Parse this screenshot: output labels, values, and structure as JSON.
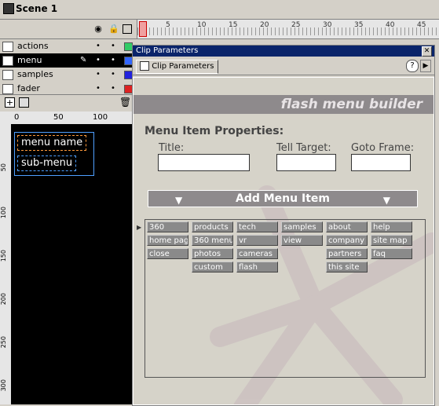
{
  "scene": {
    "title": "Scene 1"
  },
  "timeline": {
    "ruler_numbers": [
      "1",
      "5",
      "10",
      "15",
      "20",
      "25",
      "30",
      "35",
      "40",
      "45"
    ]
  },
  "layers": [
    {
      "name": "actions",
      "color": "#33cc66",
      "selected": false
    },
    {
      "name": "menu",
      "color": "#3366ff",
      "selected": true
    },
    {
      "name": "samples",
      "color": "#2222dd",
      "selected": false
    },
    {
      "name": "fader",
      "color": "#dd2222",
      "selected": false
    }
  ],
  "stage": {
    "ruler_numbers": [
      "0",
      "50",
      "100"
    ],
    "vruler_numbers": [
      "50",
      "100",
      "150",
      "200",
      "250",
      "300"
    ],
    "menu_name": "menu name",
    "sub_menu": "sub-menu"
  },
  "panel": {
    "title": "Clip Parameters",
    "tab_label": "Clip Parameters",
    "help": "?",
    "banner": "flash menu builder",
    "heading": "Menu Item Properties:",
    "fields": {
      "title_label": "Title:",
      "tell_target_label": "Tell Target:",
      "goto_frame_label": "Goto Frame:",
      "title_value": "",
      "tell_target_value": "",
      "goto_frame_value": ""
    },
    "add_button": "Add Menu Item",
    "menu_columns": [
      [
        "360",
        "home page",
        "close"
      ],
      [
        "products",
        "360 menus",
        "photos",
        "custom"
      ],
      [
        "tech",
        "vr",
        "cameras",
        "flash"
      ],
      [
        "samples",
        "view"
      ],
      [
        "about",
        "company",
        "partners",
        "this site"
      ],
      [
        "help",
        "site map",
        "faq"
      ]
    ]
  }
}
